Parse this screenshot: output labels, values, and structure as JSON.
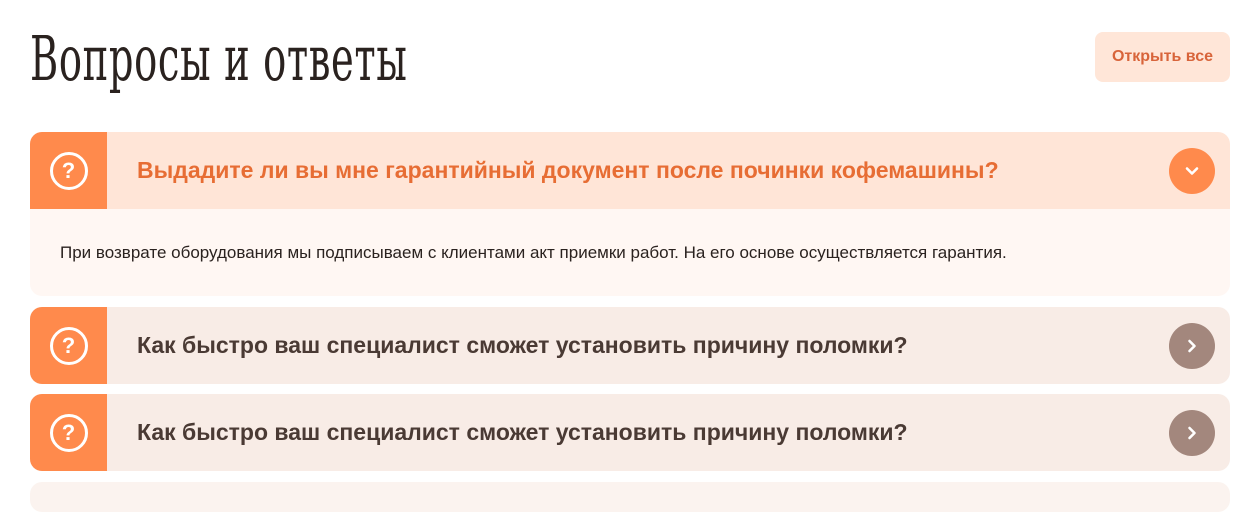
{
  "page": {
    "title": "Вопросы и ответы",
    "open_all_label": "Открыть все"
  },
  "faq": {
    "items": [
      {
        "question": "Выдадите ли вы мне гарантийный документ после починки кофемашины?",
        "answer": "При возврате оборудования мы подписываем с клиентами акт приемки работ. На его основе осуществляется гарантия.",
        "expanded": true
      },
      {
        "question": "Как быстро ваш специалист сможет установить причину поломки?",
        "expanded": false
      },
      {
        "question": "Как быстро ваш специалист сможет установить причину поломки?",
        "expanded": false
      }
    ],
    "icons": {
      "question": "question-circle-icon",
      "expanded": "chevron-down-icon",
      "collapsed": "chevron-right-icon"
    }
  },
  "colors": {
    "accent": "#ff8a4c",
    "accent_text": "#e76d34",
    "button_bg": "#ffe6d8",
    "collapsed_toggle": "#a3877d"
  }
}
